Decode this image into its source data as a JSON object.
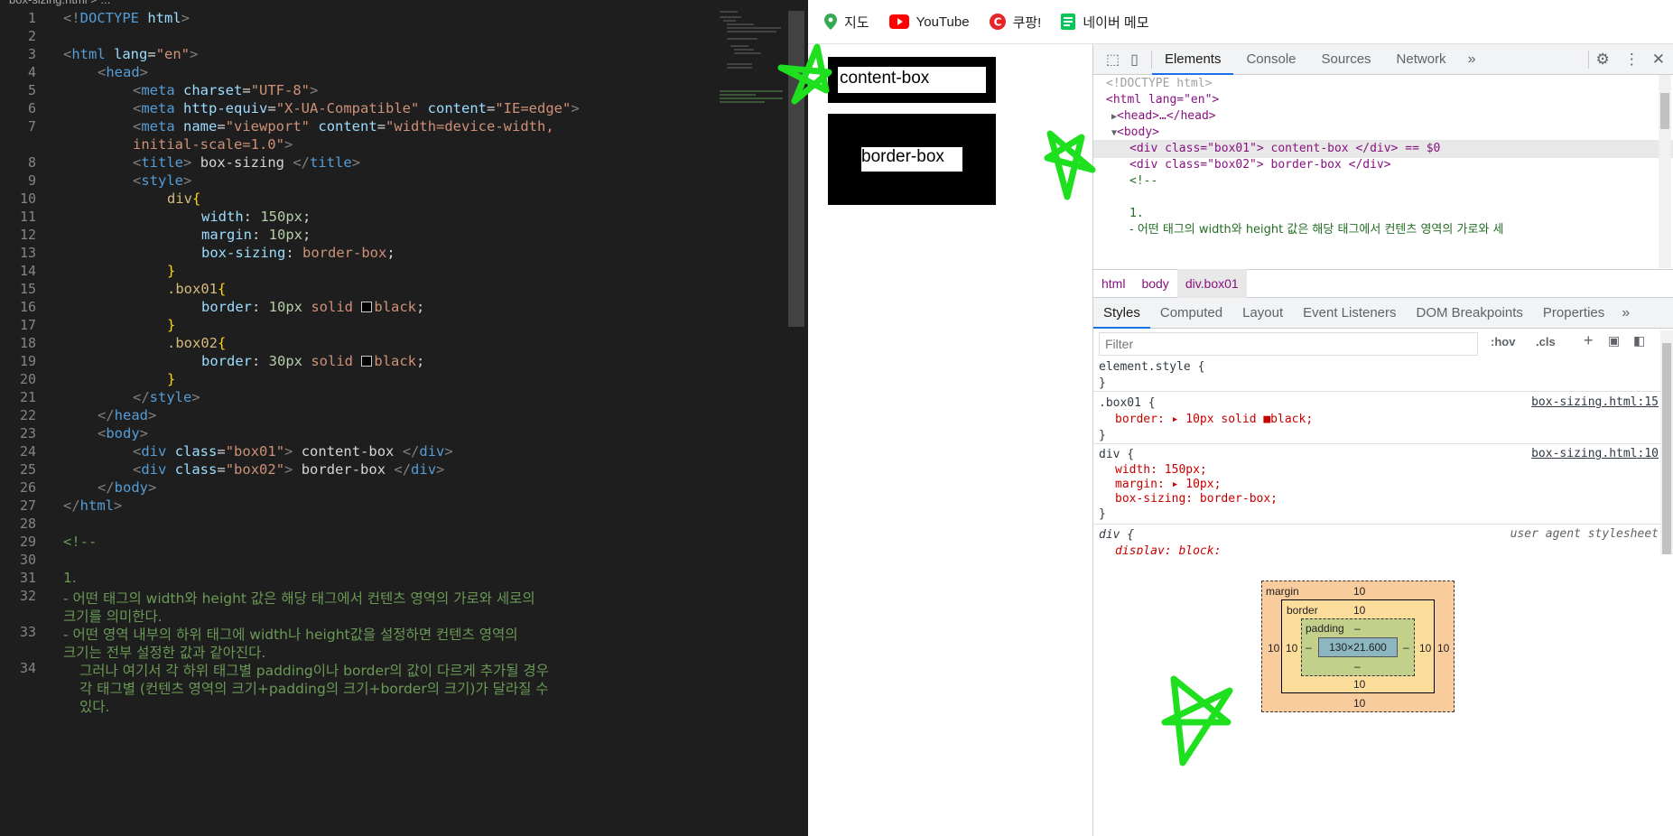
{
  "editor": {
    "tab_path": "box-sizing.html > ...",
    "line_numbers": [
      "1",
      "2",
      "3",
      "4",
      "5",
      "6",
      "7",
      "8",
      "9",
      "10",
      "11",
      "12",
      "13",
      "14",
      "15",
      "16",
      "17",
      "18",
      "19",
      "20",
      "21",
      "22",
      "23",
      "24",
      "25",
      "26",
      "27",
      "28",
      "29",
      "30",
      "31",
      "32",
      "33",
      "34"
    ],
    "code": {
      "l1": "<!DOCTYPE html>",
      "l3": "<html lang=\"en\">",
      "l4": "<head>",
      "l5": "<meta charset=\"UTF-8\">",
      "l6": "<meta http-equiv=\"X-UA-Compatible\" content=\"IE=edge\">",
      "l7a": "<meta name=\"viewport\" content=\"width=device-width,",
      "l7b": "initial-scale=1.0\">",
      "l8": "<title> box-sizing </title>",
      "l9": "<style>",
      "l10": "div{",
      "l11": "width: 150px;",
      "l12": "margin: 10px;",
      "l13": "box-sizing: border-box;",
      "l14": "}",
      "l15": ".box01{",
      "l16": "border: 10px solid black;",
      "l17": "}",
      "l18": ".box02{",
      "l19": "border: 30px solid black;",
      "l20": "}",
      "l21": "</style>",
      "l22": "</head>",
      "l23": "<body>",
      "l24": "<div class=\"box01\"> content-box </div>",
      "l25": "<div class=\"box02\"> border-box </div>",
      "l26": "</body>",
      "l27": "</html>",
      "l29": "<!--",
      "l31": "1.",
      "l32a": "- 어떤 태그의 width와 height 값은 해당 태그에서 컨텐츠 영역의 가로와 세로의",
      "l32b": "크기를 의미한다.",
      "l33a": "- 어떤 영역 내부의 하위 태그에 width나 height값을 설정하면 컨텐츠 영역의",
      "l33b": "크기는 전부 설정한 값과 같아진다.",
      "l34a": "그러나 여기서 각 하위 태그별 padding이나 border의 값이 다르게 추가될 경우",
      "l34b": "각 태그별 (컨텐츠 영역의 크기+padding의 크기+border의 크기)가 달라질 수",
      "l34c": "있다."
    }
  },
  "browser": {
    "bookmarks": [
      {
        "label": "지도",
        "icon": "map-pin-icon",
        "color": "#34a853"
      },
      {
        "label": "YouTube",
        "icon": "youtube-icon",
        "color": "#ff0000"
      },
      {
        "label": "쿠팡!",
        "icon": "coupang-icon",
        "color": "#e5252a"
      },
      {
        "label": "네이버 메모",
        "icon": "naver-memo-icon",
        "color": "#03c75a"
      }
    ],
    "page": {
      "box01_text": "content-box",
      "box02_text": "border-box"
    }
  },
  "devtools": {
    "tabs": [
      "Elements",
      "Console",
      "Sources",
      "Network"
    ],
    "dom": {
      "doctype": "<!DOCTYPE html>",
      "html_open": "<html lang=\"en\">",
      "head": "<head>…</head>",
      "body": "<body>",
      "box01_line": "<div class=\"box01\"> content-box </div> == $0",
      "box02_line": "<div class=\"box02\"> border-box </div>",
      "comment_open": "<!--",
      "c1": "1.",
      "c2": "- 어떤 태그의 width와 height 값은 해당 태그에서 컨텐츠 영역의 가로와 세"
    },
    "breadcrumbs": [
      "html",
      "body",
      "div.box01"
    ],
    "styles_tabs": [
      "Styles",
      "Computed",
      "Layout",
      "Event Listeners",
      "DOM Breakpoints",
      "Properties"
    ],
    "filter_placeholder": "Filter",
    "hov": ":hov",
    "cls": ".cls",
    "rules": {
      "element_style": "element.style {",
      "close": "}",
      "box01_sel": ".box01 {",
      "box01_src": "box-sizing.html:15",
      "box01_border": "border: ▸ 10px solid ■black;",
      "div_sel": "div {",
      "div_src": "box-sizing.html:10",
      "div_width": "width: 150px;",
      "div_margin": "margin: ▸ 10px;",
      "div_boxsizing": "box-sizing: border-box;",
      "ua_sel": "div {",
      "ua_src": "user agent stylesheet",
      "ua_display": "display: block;"
    },
    "box_model": {
      "margin_label": "margin",
      "border_label": "border",
      "padding_label": "padding",
      "margin": "10",
      "border": "10",
      "padding": "–",
      "content": "130×21.600"
    }
  }
}
